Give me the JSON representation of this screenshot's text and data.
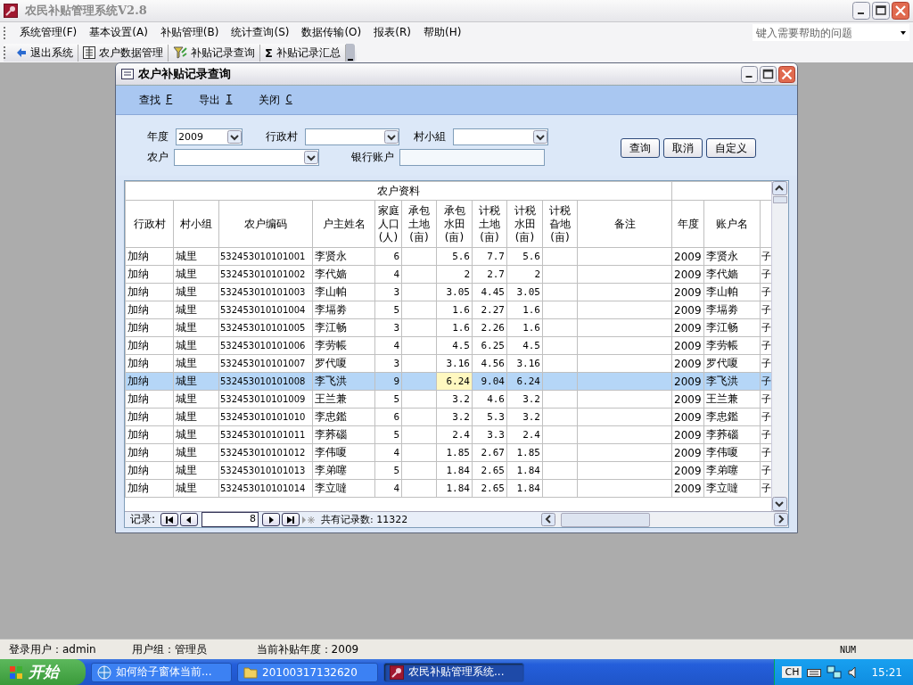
{
  "window": {
    "title": "农民补贴管理系统V2.8"
  },
  "menu": [
    "系统管理(F)",
    "基本设置(A)",
    "补贴管理(B)",
    "统计查询(S)",
    "数据传输(O)",
    "报表(R)",
    "帮助(H)"
  ],
  "help_search": {
    "placeholder": "键入需要帮助的问题"
  },
  "toolbar": [
    {
      "kind": "exit",
      "label": "退出系统"
    },
    {
      "kind": "form",
      "label": "农户数据管理"
    },
    {
      "kind": "filter",
      "label": "补贴记录查询"
    },
    {
      "kind": "sum",
      "glyph": "Σ",
      "label": "补贴记录汇总"
    }
  ],
  "query_window": {
    "title": "农户补贴记录查询",
    "commands": [
      {
        "label": "查找",
        "key": "F"
      },
      {
        "label": "导出",
        "key": "I"
      },
      {
        "label": "关闭",
        "key": "C"
      }
    ],
    "filters": [
      {
        "kind": "combo",
        "label": "年度",
        "value": "2009"
      },
      {
        "kind": "combo",
        "label": "行政村"
      },
      {
        "kind": "combo",
        "label": "村小組"
      },
      {
        "kind": "combo",
        "label": "农户"
      },
      {
        "kind": "text",
        "label": "银行账户"
      }
    ],
    "buttons": [
      "查询",
      "取消",
      "自定义"
    ],
    "table": {
      "group_header": "农户资料",
      "columns": [
        {
          "label": "行政村",
          "kind": "text"
        },
        {
          "label": "村小组",
          "kind": "text"
        },
        {
          "label": "农户编码",
          "kind": "text"
        },
        {
          "label": "户主姓名",
          "kind": "text"
        },
        {
          "label": "家庭人口(人)",
          "kind": "number"
        },
        {
          "label": "承包土地(亩)",
          "kind": "number"
        },
        {
          "label": "承包水田(亩)",
          "kind": "number"
        },
        {
          "label": "计税土地(亩)",
          "kind": "number"
        },
        {
          "label": "计税水田(亩)",
          "kind": "number"
        },
        {
          "label": "计税旮地(亩)",
          "kind": "number"
        },
        {
          "label": "备注",
          "kind": "text"
        },
        {
          "label": "年度",
          "kind": "text"
        },
        {
          "label": "账户名",
          "kind": "text"
        },
        {
          "kind": "text"
        }
      ],
      "rows": [
        {
          "selected": false,
          "cells": [
            "加纳",
            "城里",
            "532453010101001",
            "李贤永",
            "6",
            null,
            "5.6",
            "7.7",
            "5.6",
            null,
            null,
            "2009",
            "李贤永",
            "子"
          ]
        },
        {
          "selected": false,
          "cells": [
            "加纳",
            "城里",
            "532453010101002",
            "李代嫱",
            "4",
            null,
            "2",
            "2.7",
            "2",
            null,
            null,
            "2009",
            "李代嫱",
            "子"
          ]
        },
        {
          "selected": false,
          "cells": [
            "加纳",
            "城里",
            "532453010101003",
            "李山帕",
            "3",
            null,
            "3.05",
            "4.45",
            "3.05",
            null,
            null,
            "2009",
            "李山帕",
            "子"
          ]
        },
        {
          "selected": false,
          "cells": [
            "加纳",
            "城里",
            "532453010101004",
            "李塥劵",
            "5",
            null,
            "1.6",
            "2.27",
            "1.6",
            null,
            null,
            "2009",
            "李塥劵",
            "子"
          ]
        },
        {
          "selected": false,
          "cells": [
            "加纳",
            "城里",
            "532453010101005",
            "李江畅",
            "3",
            null,
            "1.6",
            "2.26",
            "1.6",
            null,
            null,
            "2009",
            "李江畅",
            "子"
          ]
        },
        {
          "selected": false,
          "cells": [
            "加纳",
            "城里",
            "532453010101006",
            "李劳帳",
            "4",
            null,
            "4.5",
            "6.25",
            "4.5",
            null,
            null,
            "2009",
            "李劳帳",
            "子"
          ]
        },
        {
          "selected": false,
          "cells": [
            "加纳",
            "城里",
            "532453010101007",
            "罗代嗄",
            "3",
            null,
            "3.16",
            "4.56",
            "3.16",
            null,
            null,
            "2009",
            "罗代嗄",
            "子"
          ]
        },
        {
          "selected": true,
          "cells": [
            "加纳",
            "城里",
            "532453010101008",
            "李飞洪",
            "9",
            null,
            {
              "text": "6.24",
              "focused": true
            },
            "9.04",
            "6.24",
            null,
            null,
            "2009",
            "李飞洪",
            "子"
          ]
        },
        {
          "selected": false,
          "cells": [
            "加纳",
            "城里",
            "532453010101009",
            "王兰兼",
            "5",
            null,
            "3.2",
            "4.6",
            "3.2",
            null,
            null,
            "2009",
            "王兰兼",
            "子"
          ]
        },
        {
          "selected": false,
          "cells": [
            "加纳",
            "城里",
            "532453010101010",
            "李忠鑑",
            "6",
            null,
            "3.2",
            "5.3",
            "3.2",
            null,
            null,
            "2009",
            "李忠鑑",
            "子"
          ]
        },
        {
          "selected": false,
          "cells": [
            "加纳",
            "城里",
            "532453010101011",
            "李荞碯",
            "5",
            null,
            "2.4",
            "3.3",
            "2.4",
            null,
            null,
            "2009",
            "李荞碯",
            "子"
          ]
        },
        {
          "selected": false,
          "cells": [
            "加纳",
            "城里",
            "532453010101012",
            "李伟嗄",
            "4",
            null,
            "1.85",
            "2.67",
            "1.85",
            null,
            null,
            "2009",
            "李伟嗄",
            "子"
          ]
        },
        {
          "selected": false,
          "cells": [
            "加纳",
            "城里",
            "532453010101013",
            "李弟噻",
            "5",
            null,
            "1.84",
            "2.65",
            "1.84",
            null,
            null,
            "2009",
            "李弟噻",
            "子"
          ]
        },
        {
          "selected": false,
          "cells": [
            "加纳",
            "城里",
            "532453010101014",
            "李立噠",
            "4",
            null,
            "1.84",
            "2.65",
            "1.84",
            null,
            null,
            "2009",
            "李立噠",
            "子"
          ]
        }
      ]
    },
    "navigator": {
      "label": "记录:",
      "current": "8",
      "total": "共有记录数: 11322"
    }
  },
  "status_bar": [
    "登录用户：admin",
    "用户组：管理员",
    "当前补贴年度：2009",
    "NUM"
  ],
  "taskbar": {
    "start": "开始",
    "tasks": [
      {
        "kind": "browser",
        "label": "如何给子窗体当前...",
        "selected": false
      },
      {
        "kind": "folder",
        "label": "20100317132620",
        "selected": false
      },
      {
        "kind": "app",
        "label": "农民补贴管理系统...",
        "selected": true
      }
    ],
    "tray": {
      "language": "CH",
      "time": "15:21"
    }
  }
}
